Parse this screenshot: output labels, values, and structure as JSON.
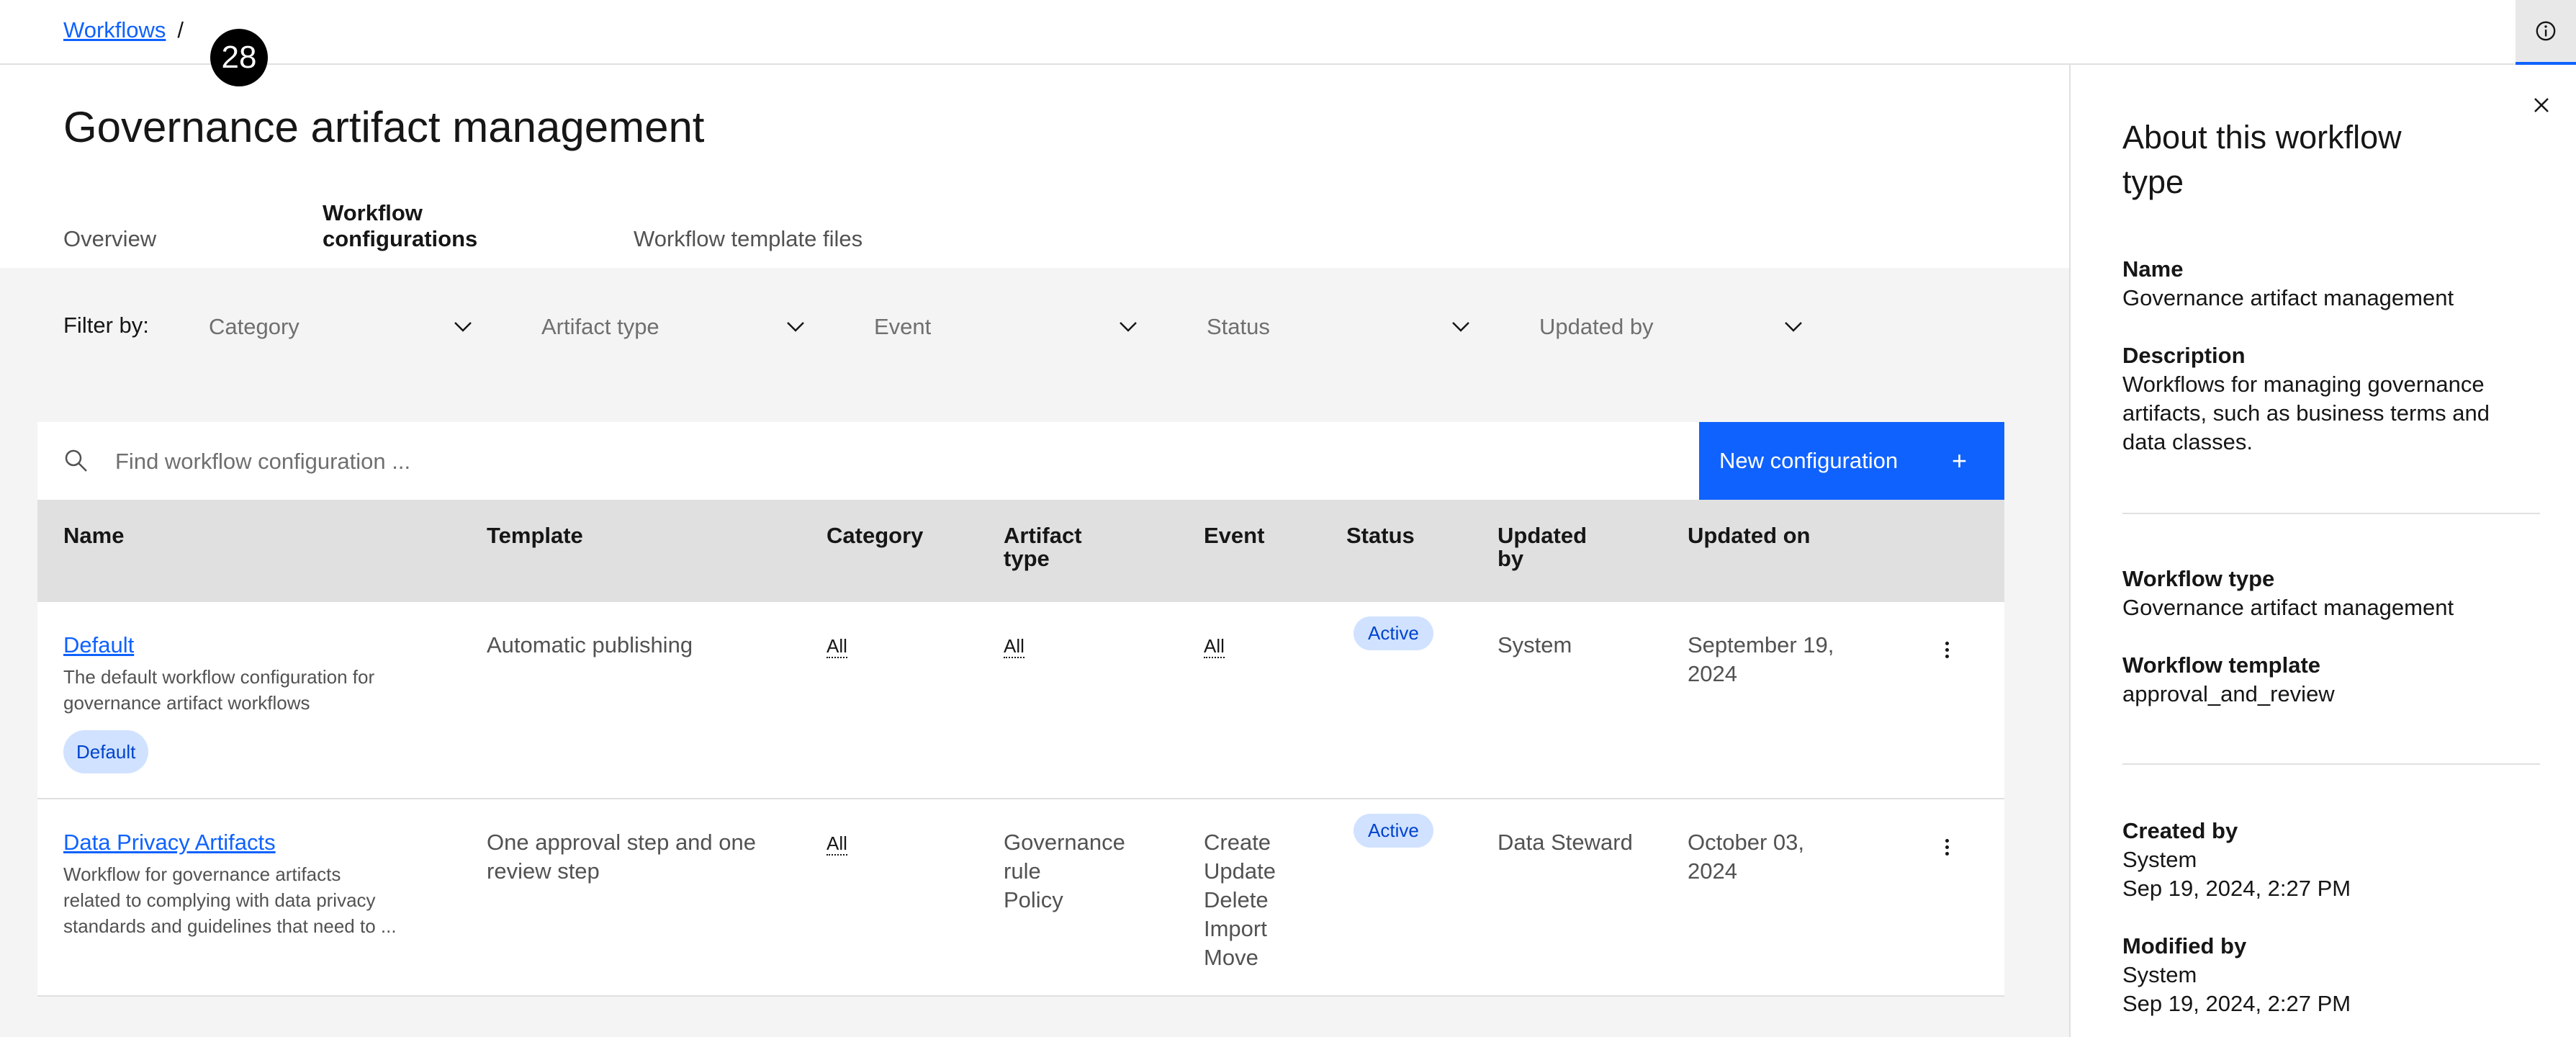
{
  "breadcrumb": {
    "root": "Workflows",
    "separator": "/"
  },
  "step_badge": "28",
  "page_title": "Governance artifact management",
  "tabs": [
    {
      "label": "Overview",
      "active": false
    },
    {
      "label": "Workflow configurations",
      "active": true
    },
    {
      "label": "Workflow template files",
      "active": false
    }
  ],
  "filters": {
    "label": "Filter by:",
    "dropdowns": [
      {
        "label": "Category"
      },
      {
        "label": "Artifact type"
      },
      {
        "label": "Event"
      },
      {
        "label": "Status"
      },
      {
        "label": "Updated by"
      }
    ]
  },
  "search": {
    "placeholder": "Find workflow configuration ..."
  },
  "new_config_button": {
    "label": "New configuration",
    "icon": "plus-icon"
  },
  "table": {
    "headers": {
      "name": "Name",
      "template": "Template",
      "category": "Category",
      "artifact_type_1": "Artifact",
      "artifact_type_2": "type",
      "event": "Event",
      "status": "Status",
      "updated_by_1": "Updated",
      "updated_by_2": "by",
      "updated_on": "Updated on"
    },
    "rows": [
      {
        "name": "Default",
        "desc_1": "The default workflow configuration for",
        "desc_2": "governance artifact workflows",
        "desc_3": "",
        "tag": "Default",
        "template": "Automatic publishing",
        "template_2": "",
        "category": "All",
        "artifact_type": [
          "All"
        ],
        "event": [
          "All"
        ],
        "status": "Active",
        "updated_by": "System",
        "updated_on_1": "September 19,",
        "updated_on_2": "2024"
      },
      {
        "name": "Data Privacy Artifacts",
        "desc_1": "Workflow for governance artifacts",
        "desc_2": "related to complying with data privacy",
        "desc_3": "standards and guidelines that need to ...",
        "tag": "",
        "template": "One approval step and one",
        "template_2": "review step",
        "category": "All",
        "artifact_type": [
          "Governance",
          "rule",
          "Policy"
        ],
        "event": [
          "Create",
          "Update",
          "Delete",
          "Import",
          "Move"
        ],
        "status": "Active",
        "updated_by": "Data Steward",
        "updated_on_1": "October 03,",
        "updated_on_2": "2024"
      }
    ]
  },
  "side_panel": {
    "title": "About this workflow type",
    "name_label": "Name",
    "name_value": "Governance artifact management",
    "description_label": "Description",
    "description_1": "Workflows for managing governance",
    "description_2": "artifacts, such as business terms and",
    "description_3": "data classes.",
    "workflow_type_label": "Workflow type",
    "workflow_type_value": "Governance artifact management",
    "workflow_template_label": "Workflow template",
    "workflow_template_value": "approval_and_review",
    "created_by_label": "Created by",
    "created_by_value": "System",
    "created_on": "Sep 19, 2024, 2:27 PM",
    "modified_by_label": "Modified by",
    "modified_by_value": "System",
    "modified_on": "Sep 19, 2024, 2:27 PM"
  },
  "colors": {
    "accent": "#0f62fe",
    "tag_bg": "#d0e2ff",
    "tag_text": "#0043ce",
    "header_bg": "#e0e0e0",
    "content_bg": "#f4f4f4"
  }
}
